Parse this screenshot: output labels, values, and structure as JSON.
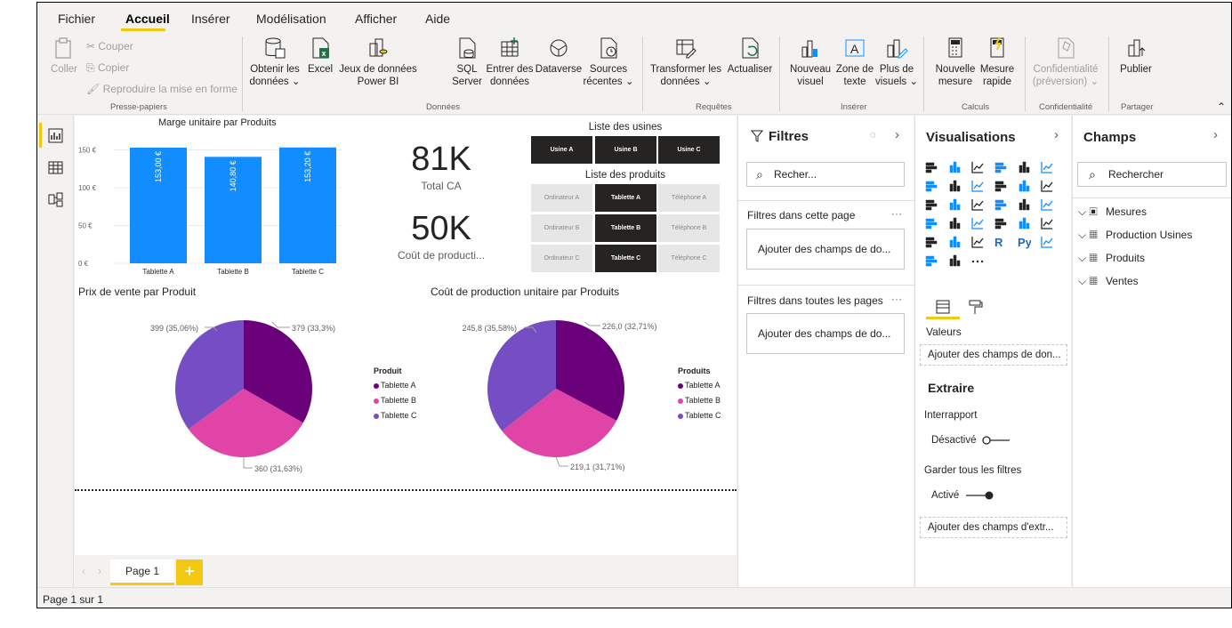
{
  "menu": {
    "tabs": [
      "Fichier",
      "Accueil",
      "Insérer",
      "Modélisation",
      "Afficher",
      "Aide"
    ]
  },
  "ribbon": {
    "clipboard": {
      "paste": "Coller",
      "cut": "Couper",
      "copy": "Copier",
      "format_painter": "Reproduire la mise en forme",
      "group": "Presse-papiers"
    },
    "data": {
      "get_data": "Obtenir les données ⌄",
      "excel": "Excel",
      "pbi_datasets": "Jeux de données Power BI",
      "sql": "SQL Server",
      "enter_data": "Entrer des données",
      "dataverse": "Dataverse",
      "recent": "Sources récentes ⌄",
      "group": "Données"
    },
    "queries": {
      "transform": "Transformer les données ⌄",
      "refresh": "Actualiser",
      "group": "Requêtes"
    },
    "insert": {
      "new_visual": "Nouveau visuel",
      "textbox": "Zone de texte",
      "more_visuals": "Plus de visuels ⌄",
      "group": "Insérer"
    },
    "calc": {
      "new_measure": "Nouvelle mesure",
      "quick_measure": "Mesure rapide",
      "group": "Calculs"
    },
    "sensitivity": {
      "label": "Confidentialité (préversion) ⌄",
      "group": "Confidentialité"
    },
    "share": {
      "publish": "Publier",
      "group": "Partager"
    }
  },
  "canvas": {
    "bar_title": "Marge unitaire par Produits",
    "bar_yticks": [
      "150 €",
      "100 €",
      "50 €",
      "0 €"
    ],
    "kpi1_value": "81K",
    "kpi1_label": "Total CA",
    "kpi2_value": "50K",
    "kpi2_label": "Coût de producti...",
    "slicer1_title": "Liste des usines",
    "slicer1_items": [
      "Usine A",
      "Usine B",
      "Usine C"
    ],
    "slicer2_title": "Liste des produits",
    "slicer2_items": [
      [
        "Ordinateur A",
        "Tablette A",
        "Téléphone A"
      ],
      [
        "Ordinateur B",
        "Tablette B",
        "Téléphone B"
      ],
      [
        "Ordinateur C",
        "Tablette C",
        "Téléphone C"
      ]
    ],
    "pie1_title": "Prix de vente par Produit",
    "pie1_legend_title": "Produit",
    "pie2_title": "Coût de production unitaire par Produits",
    "pie2_legend_title": "Produits"
  },
  "chart_data": [
    {
      "type": "bar",
      "title": "Marge unitaire par Produits",
      "categories": [
        "Tablette A",
        "Tablette B",
        "Tablette C"
      ],
      "values": [
        153.0,
        140.8,
        153.2
      ],
      "data_labels": [
        "153,00 €",
        "140,80 €",
        "153,20 €"
      ],
      "ylim": [
        0,
        160
      ],
      "color": "#118dff"
    },
    {
      "type": "pie",
      "title": "Prix de vente par Produit",
      "legend_title": "Produit",
      "categories": [
        "Tablette A",
        "Tablette B",
        "Tablette C"
      ],
      "values": [
        379,
        360,
        399
      ],
      "data_labels": [
        "379 (33,3%)",
        "360 (31,63%)",
        "399 (35,06%)"
      ],
      "colors": [
        "#6b007b",
        "#e044a7",
        "#744ec2"
      ]
    },
    {
      "type": "pie",
      "title": "Coût de production unitaire par Produits",
      "legend_title": "Produits",
      "categories": [
        "Tablette A",
        "Tablette B",
        "Tablette C"
      ],
      "values": [
        226.0,
        219.1,
        245.8
      ],
      "data_labels": [
        "226,0 (32,71%)",
        "219,1 (31,71%)",
        "245,8 (35,58%)"
      ],
      "colors": [
        "#6b007b",
        "#e044a7",
        "#744ec2"
      ]
    }
  ],
  "pagebar": {
    "page_tab": "Page 1",
    "add": "+"
  },
  "status": {
    "text": "Page 1 sur 1"
  },
  "filters": {
    "title": "Filtres",
    "search_placeholder": "Recher...",
    "this_page": "Filtres dans cette page",
    "all_pages": "Filtres dans toutes les pages",
    "add_fields": "Ajouter des champs de do...",
    "more": "···"
  },
  "visualizations": {
    "title": "Visualisations",
    "values_label": "Valeurs",
    "add_data_fields": "Ajouter des champs de don...",
    "drill_title": "Extraire",
    "cross_report": "Interrapport",
    "cross_report_state": "Désactivé",
    "keep_filters": "Garder tous les filtres",
    "keep_filters_state": "Activé",
    "add_drill_fields": "Ajouter des champs d'extr..."
  },
  "fields": {
    "title": "Champs",
    "search_placeholder": "Rechercher",
    "tables": [
      "Mesures",
      "Production Usines",
      "Produits",
      "Ventes"
    ]
  }
}
